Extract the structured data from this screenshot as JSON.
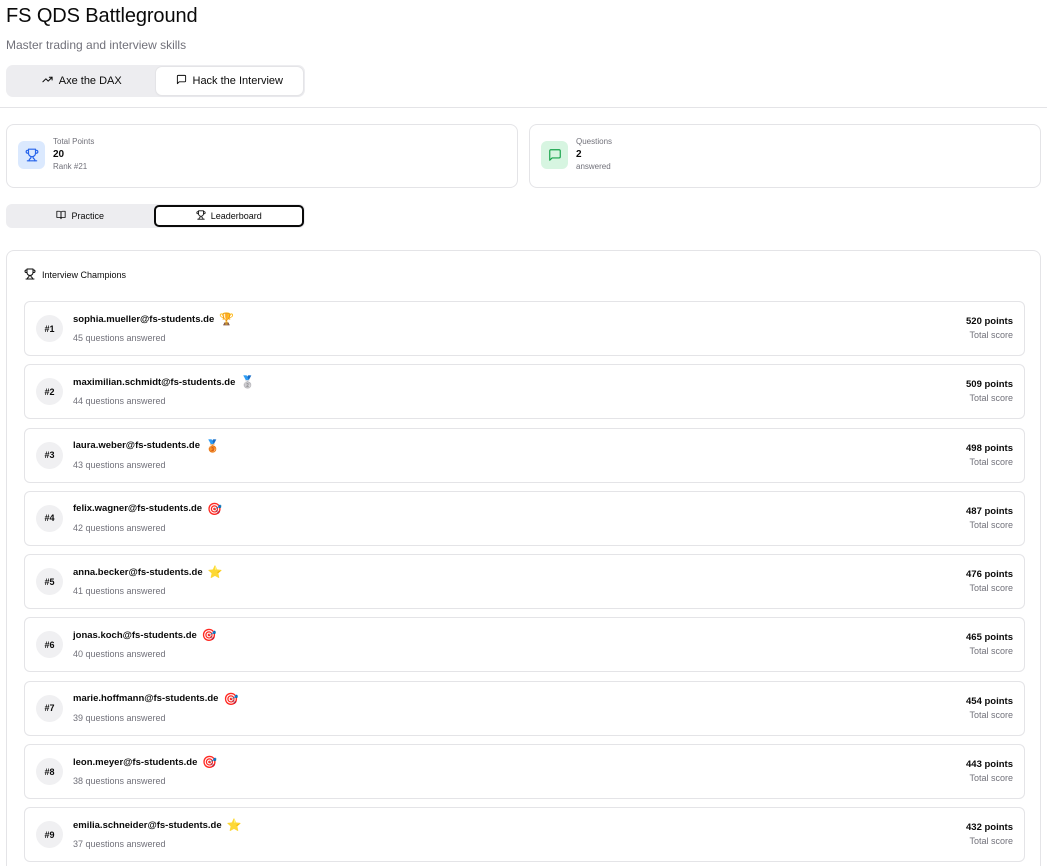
{
  "app": {
    "title": "FS QDS Battleground",
    "subtitle": "Master trading and interview skills"
  },
  "mode_tabs": [
    {
      "label": "Axe the DAX",
      "icon": "trending-up-icon",
      "active": false
    },
    {
      "label": "Hack the Interview",
      "icon": "message-square-icon",
      "active": true
    }
  ],
  "stats": {
    "points": {
      "label": "Total Points",
      "value": "20",
      "sub": "Rank #21",
      "icon": "trophy-icon",
      "color": "#2563eb"
    },
    "questions": {
      "label": "Questions",
      "value": "2",
      "sub": "answered",
      "icon": "message-square-icon",
      "color": "#16a34a"
    }
  },
  "view_tabs": [
    {
      "label": "Practice",
      "icon": "book-open-icon",
      "active": false
    },
    {
      "label": "Leaderboard",
      "icon": "trophy-icon",
      "active": true
    }
  ],
  "leaderboard": {
    "title": "Interview Champions",
    "score_label": "Total score",
    "rows": [
      {
        "rank": "#1",
        "email": "sophia.mueller@fs-students.de",
        "badge": "🏆",
        "answered": "45 questions answered",
        "points": "520 points"
      },
      {
        "rank": "#2",
        "email": "maximilian.schmidt@fs-students.de",
        "badge": "🥈",
        "answered": "44 questions answered",
        "points": "509 points"
      },
      {
        "rank": "#3",
        "email": "laura.weber@fs-students.de",
        "badge": "🥉",
        "answered": "43 questions answered",
        "points": "498 points"
      },
      {
        "rank": "#4",
        "email": "felix.wagner@fs-students.de",
        "badge": "🎯",
        "answered": "42 questions answered",
        "points": "487 points"
      },
      {
        "rank": "#5",
        "email": "anna.becker@fs-students.de",
        "badge": "⭐",
        "answered": "41 questions answered",
        "points": "476 points"
      },
      {
        "rank": "#6",
        "email": "jonas.koch@fs-students.de",
        "badge": "🎯",
        "answered": "40 questions answered",
        "points": "465 points"
      },
      {
        "rank": "#7",
        "email": "marie.hoffmann@fs-students.de",
        "badge": "🎯",
        "answered": "39 questions answered",
        "points": "454 points"
      },
      {
        "rank": "#8",
        "email": "leon.meyer@fs-students.de",
        "badge": "🎯",
        "answered": "38 questions answered",
        "points": "443 points"
      },
      {
        "rank": "#9",
        "email": "emilia.schneider@fs-students.de",
        "badge": "⭐",
        "answered": "37 questions answered",
        "points": "432 points"
      }
    ]
  }
}
